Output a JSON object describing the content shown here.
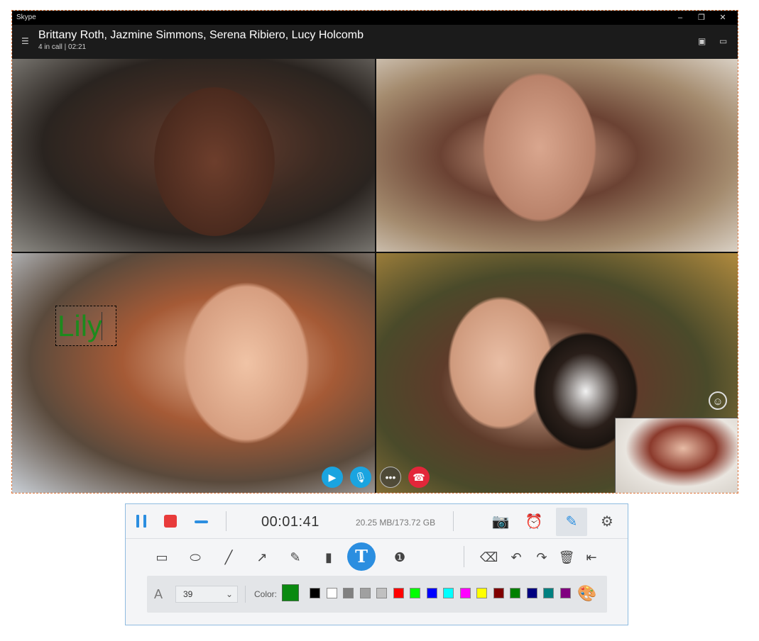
{
  "skype": {
    "app_title": "Skype",
    "window_buttons": [
      "–",
      "❐",
      "✕"
    ],
    "call_names": "Brittany Roth, Jazmine Simmons, Serena Ribiero, Lucy Holcomb",
    "call_status": "4 in call | 02:21",
    "annotation_text": "Lily",
    "call_controls": {
      "video_icon": "video-icon",
      "mic_icon": "mic-icon",
      "more_label": "•••",
      "end_icon": "end-call-icon"
    }
  },
  "recorder": {
    "timer": "00:01:41",
    "size": "20.25 MB/173.72 GB",
    "font_letter": "A",
    "font_size": "39",
    "color_label": "Color:",
    "current_color": "#0a8a10",
    "text_tool_label": "T",
    "swatches": [
      "#000000",
      "#ffffff",
      "#808080",
      "#a0a0a0",
      "#c0c0c0",
      "#ff0000",
      "#00ff00",
      "#0000ff",
      "#00ffff",
      "#ff00ff",
      "#ffff00",
      "#800000",
      "#008000",
      "#000080",
      "#008080",
      "#800080"
    ]
  }
}
